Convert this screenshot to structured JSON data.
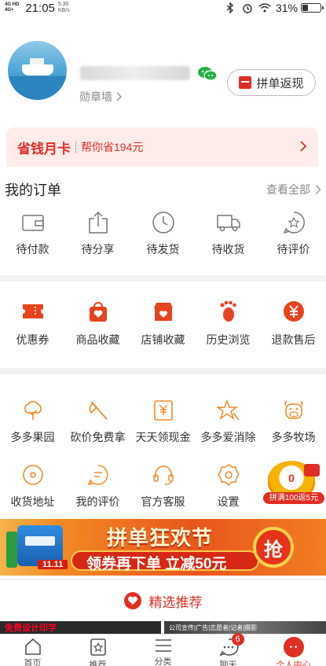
{
  "status_bar": {
    "network_top": "4G HD",
    "network_bottom": "4G+",
    "time": "21:05",
    "speed_value": "5.30",
    "speed_unit": "KB/s",
    "battery_percent": "31%",
    "battery_level": 0.31
  },
  "profile": {
    "badge_wall_label": "勋章墙",
    "group_return_button": "拼单返现"
  },
  "money_card": {
    "title": "省钱月卡",
    "subtitle": "帮你省194元"
  },
  "orders": {
    "title": "我的订单",
    "view_all": "查看全部",
    "items": [
      {
        "label": "待付款",
        "icon": "wallet-icon"
      },
      {
        "label": "待分享",
        "icon": "share-icon"
      },
      {
        "label": "待发货",
        "icon": "clock-icon"
      },
      {
        "label": "待收货",
        "icon": "truck-icon"
      },
      {
        "label": "待评价",
        "icon": "review-icon"
      }
    ]
  },
  "favorites": {
    "items": [
      {
        "label": "优惠券",
        "icon": "coupon-icon"
      },
      {
        "label": "商品收藏",
        "icon": "goods-favorite-icon"
      },
      {
        "label": "店铺收藏",
        "icon": "store-favorite-icon"
      },
      {
        "label": "历史浏览",
        "icon": "footprint-icon"
      },
      {
        "label": "退款售后",
        "icon": "refund-icon"
      }
    ]
  },
  "tools": {
    "row1": [
      {
        "label": "多多果园",
        "icon": "tree-icon"
      },
      {
        "label": "砍价免费拿",
        "icon": "axe-icon"
      },
      {
        "label": "天天领现金",
        "icon": "cash-icon"
      },
      {
        "label": "多多爱消除",
        "icon": "star-icon"
      },
      {
        "label": "多多牧场",
        "icon": "cow-icon"
      }
    ],
    "row2": [
      {
        "label": "收货地址",
        "icon": "location-icon"
      },
      {
        "label": "我的评价",
        "icon": "comment-icon"
      },
      {
        "label": "官方客服",
        "icon": "headset-icon"
      },
      {
        "label": "设置",
        "icon": "gear-icon"
      }
    ]
  },
  "float_promo": {
    "count": "0",
    "ribbon": "拼满100返5元"
  },
  "banner": {
    "title": "拼单狂欢节",
    "subtitle": "领券再下单 立减50元",
    "grab": "抢",
    "date_tag": "11.11"
  },
  "recommend": {
    "label": "精选推荐"
  },
  "thumbs": {
    "left_text": "免费设计印字",
    "right_text": "公司宣传|广告|志愿者|记者|摄影"
  },
  "tabbar": {
    "items": [
      {
        "label": "首页",
        "icon": "home-icon"
      },
      {
        "label": "推荐",
        "icon": "recommend-icon"
      },
      {
        "label": "分类",
        "icon": "category-icon"
      },
      {
        "label": "聊天",
        "icon": "chat-icon",
        "badge": "6"
      },
      {
        "label": "个人中心",
        "icon": "profile-icon"
      }
    ]
  },
  "colors": {
    "accent": "#e02e24",
    "icon_orange": "#f08a2a"
  }
}
